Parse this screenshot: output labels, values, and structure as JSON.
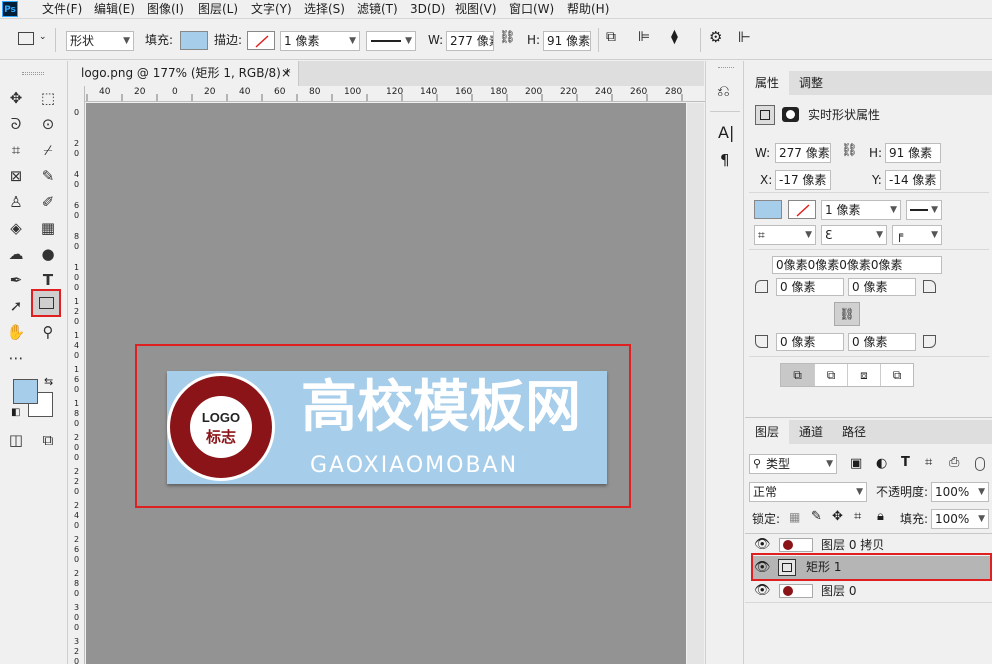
{
  "app": {
    "logo": "Ps"
  },
  "menu": [
    "文件(F)",
    "编辑(E)",
    "图像(I)",
    "图层(L)",
    "文字(Y)",
    "选择(S)",
    "滤镜(T)",
    "3D(D)",
    "视图(V)",
    "窗口(W)",
    "帮助(H)"
  ],
  "options": {
    "mode": "形状",
    "fill_label": "填充:",
    "stroke_label": "描边:",
    "stroke_width": "1 像素",
    "w_label": "W:",
    "w_value": "277 像素",
    "h_label": "H:",
    "h_value": "91 像素",
    "fill_color": "#a6cde9"
  },
  "document": {
    "tab_title": "logo.png @ 177% (矩形 1, RGB/8) *",
    "close": "×",
    "hruler_ticks": [
      "40",
      "20",
      "0",
      "20",
      "40",
      "60",
      "80",
      "100",
      "120",
      "140",
      "160",
      "180",
      "200",
      "220",
      "240",
      "260",
      "280"
    ],
    "vruler_ticks": [
      "0",
      "2 0",
      "4 0",
      "6 0",
      "8 0",
      "1 0 0",
      "1 2 0",
      "1 4 0",
      "1 6 0",
      "1 8 0",
      "2 0 0",
      "2 2 0",
      "2 4 0",
      "2 6 0",
      "2 8 0",
      "3 0 0",
      "3 2 0",
      "3 4 0"
    ]
  },
  "logo": {
    "badge_text": "LOGO",
    "badge_sub": "标志",
    "title": "高校模板网",
    "subtitle": "GAOXIAOMOBAN"
  },
  "properties": {
    "tab_active": "属性",
    "tab_other": "调整",
    "heading": "实时形状属性",
    "w_label": "W:",
    "w_value": "277 像素",
    "h_label": "H:",
    "h_value": "91 像素",
    "x_label": "X:",
    "x_value": "-17 像素",
    "y_label": "Y:",
    "y_value": "-14 像素",
    "stroke_width": "1 像素",
    "corner_all": "0像素0像素0像素0像素",
    "corner_tl": "0 像素",
    "corner_tr": "0 像素",
    "corner_bl": "0 像素",
    "corner_br": "0 像素"
  },
  "layers": {
    "tabs": [
      "图层",
      "通道",
      "路径"
    ],
    "filter": "类型",
    "blend_mode": "正常",
    "opacity_label": "不透明度:",
    "opacity": "100%",
    "lock_label": "锁定:",
    "fill_label": "填充:",
    "fill": "100%",
    "items": [
      {
        "name": "图层 0 拷贝"
      },
      {
        "name": "矩形 1"
      },
      {
        "name": "图层 0"
      }
    ]
  },
  "colors": {
    "highlight": "#e02020",
    "selected_layer": "#b5b5b5",
    "canvas_bg": "#939393"
  }
}
